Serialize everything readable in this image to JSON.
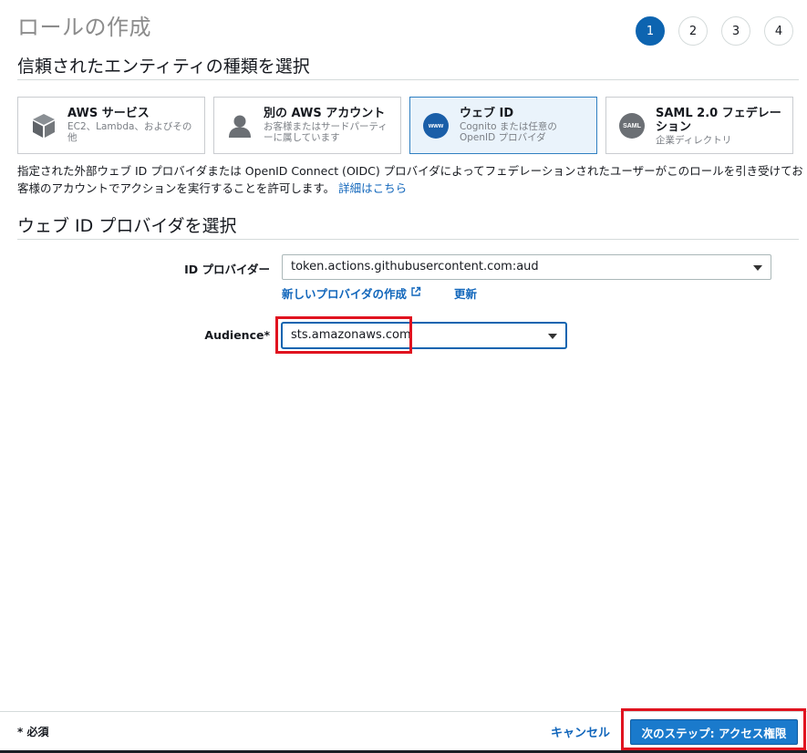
{
  "page": {
    "title": "ロールの作成"
  },
  "steps": [
    "1",
    "2",
    "3",
    "4"
  ],
  "sections": {
    "entity_type": "信頼されたエンティティの種類を選択",
    "provider": "ウェブ ID プロバイダを選択"
  },
  "entity_cards": [
    {
      "title": "AWS サービス",
      "desc": "EC2、Lambda、およびその他",
      "icon": "cube-icon",
      "selected": false
    },
    {
      "title": "別の AWS アカウント",
      "desc": "お客様またはサードパーティーに属しています",
      "icon": "person-icon",
      "selected": false
    },
    {
      "title": "ウェブ ID",
      "desc": "Cognito または任意の OpenID プロバイダ",
      "icon": "www-icon",
      "icon_text": "www",
      "selected": true
    },
    {
      "title": "SAML 2.0 フェデレーション",
      "desc": "企業ディレクトリ",
      "icon": "saml-icon",
      "icon_text": "SAML",
      "selected": false
    }
  ],
  "description": {
    "text": "指定された外部ウェブ ID プロバイダまたは OpenID Connect (OIDC) プロバイダによってフェデレーションされたユーザーがこのロールを引き受けてお客様のアカウントでアクションを実行することを許可します。",
    "link": "詳細はこちら"
  },
  "form": {
    "id_provider": {
      "label": "ID プロバイダー",
      "value": "token.actions.githubusercontent.com:aud"
    },
    "create_provider_link": "新しいプロバイダの作成",
    "refresh_link": "更新",
    "audience": {
      "label": "Audience*",
      "value": "sts.amazonaws.com"
    }
  },
  "footer": {
    "required_note": "* 必須",
    "cancel": "キャンセル",
    "next": "次のステップ: アクセス権限"
  },
  "colors": {
    "primary": "#0d64b0",
    "link": "#1166bb",
    "highlight": "#e0131f",
    "selected_card_bg": "#eaf3fb",
    "button": "#1a7acc"
  }
}
